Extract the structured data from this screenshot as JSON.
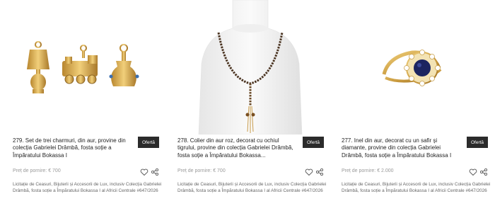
{
  "lots": [
    {
      "title": "279. Set de trei charmuri, din aur, provine din colecția Gabrielei Drâmbă, fosta soție a Împăratului Bokassa I",
      "offer_label": "Ofertă",
      "start_price": "Preț de pornire: € 700",
      "auction_note": "Licitație de Ceasuri, Bijuterii și Accesorii de Lux, inclusiv Colecția Gabrielei Drâmbă, fosta soție a Împăratului Bokassa I al Africii Centrale #647/2026",
      "icons": [
        "heart-icon",
        "share-icon"
      ]
    },
    {
      "title": "278. Colier din aur roz, decorat cu ochiul tigrului, provine din colecția Gabrielei Drâmbă, fosta soție a Împăratului Bokassa...",
      "offer_label": "Ofertă",
      "start_price": "Preț de pornire: € 700",
      "auction_note": "Licitație de Ceasuri, Bijuterii și Accesorii de Lux, inclusiv Colecția Gabrielei Drâmbă, fosta soție a Împăratului Bokassa I al Africii Centrale #647/2026",
      "icons": [
        "heart-icon",
        "share-icon"
      ]
    },
    {
      "title": "277. Inel din aur, decorat cu un safir și diamante, provine din colecția Gabrielei Drâmbă, fosta soție a Împăratului Bokassa I",
      "offer_label": "Ofertă",
      "start_price": "Preț de pornire: € 2.000",
      "auction_note": "Licitație de Ceasuri, Bijuterii și Accesorii de Lux, inclusiv Colecția Gabrielei Drâmbă, fosta soție a Împăratului Bokassa I al Africii Centrale #647/2026",
      "icons": [
        "heart-icon",
        "share-icon"
      ]
    }
  ],
  "colors": {
    "offer_button": "#2b2b2b",
    "gold": "#d4a94a",
    "price_text": "#9a9a9a"
  }
}
